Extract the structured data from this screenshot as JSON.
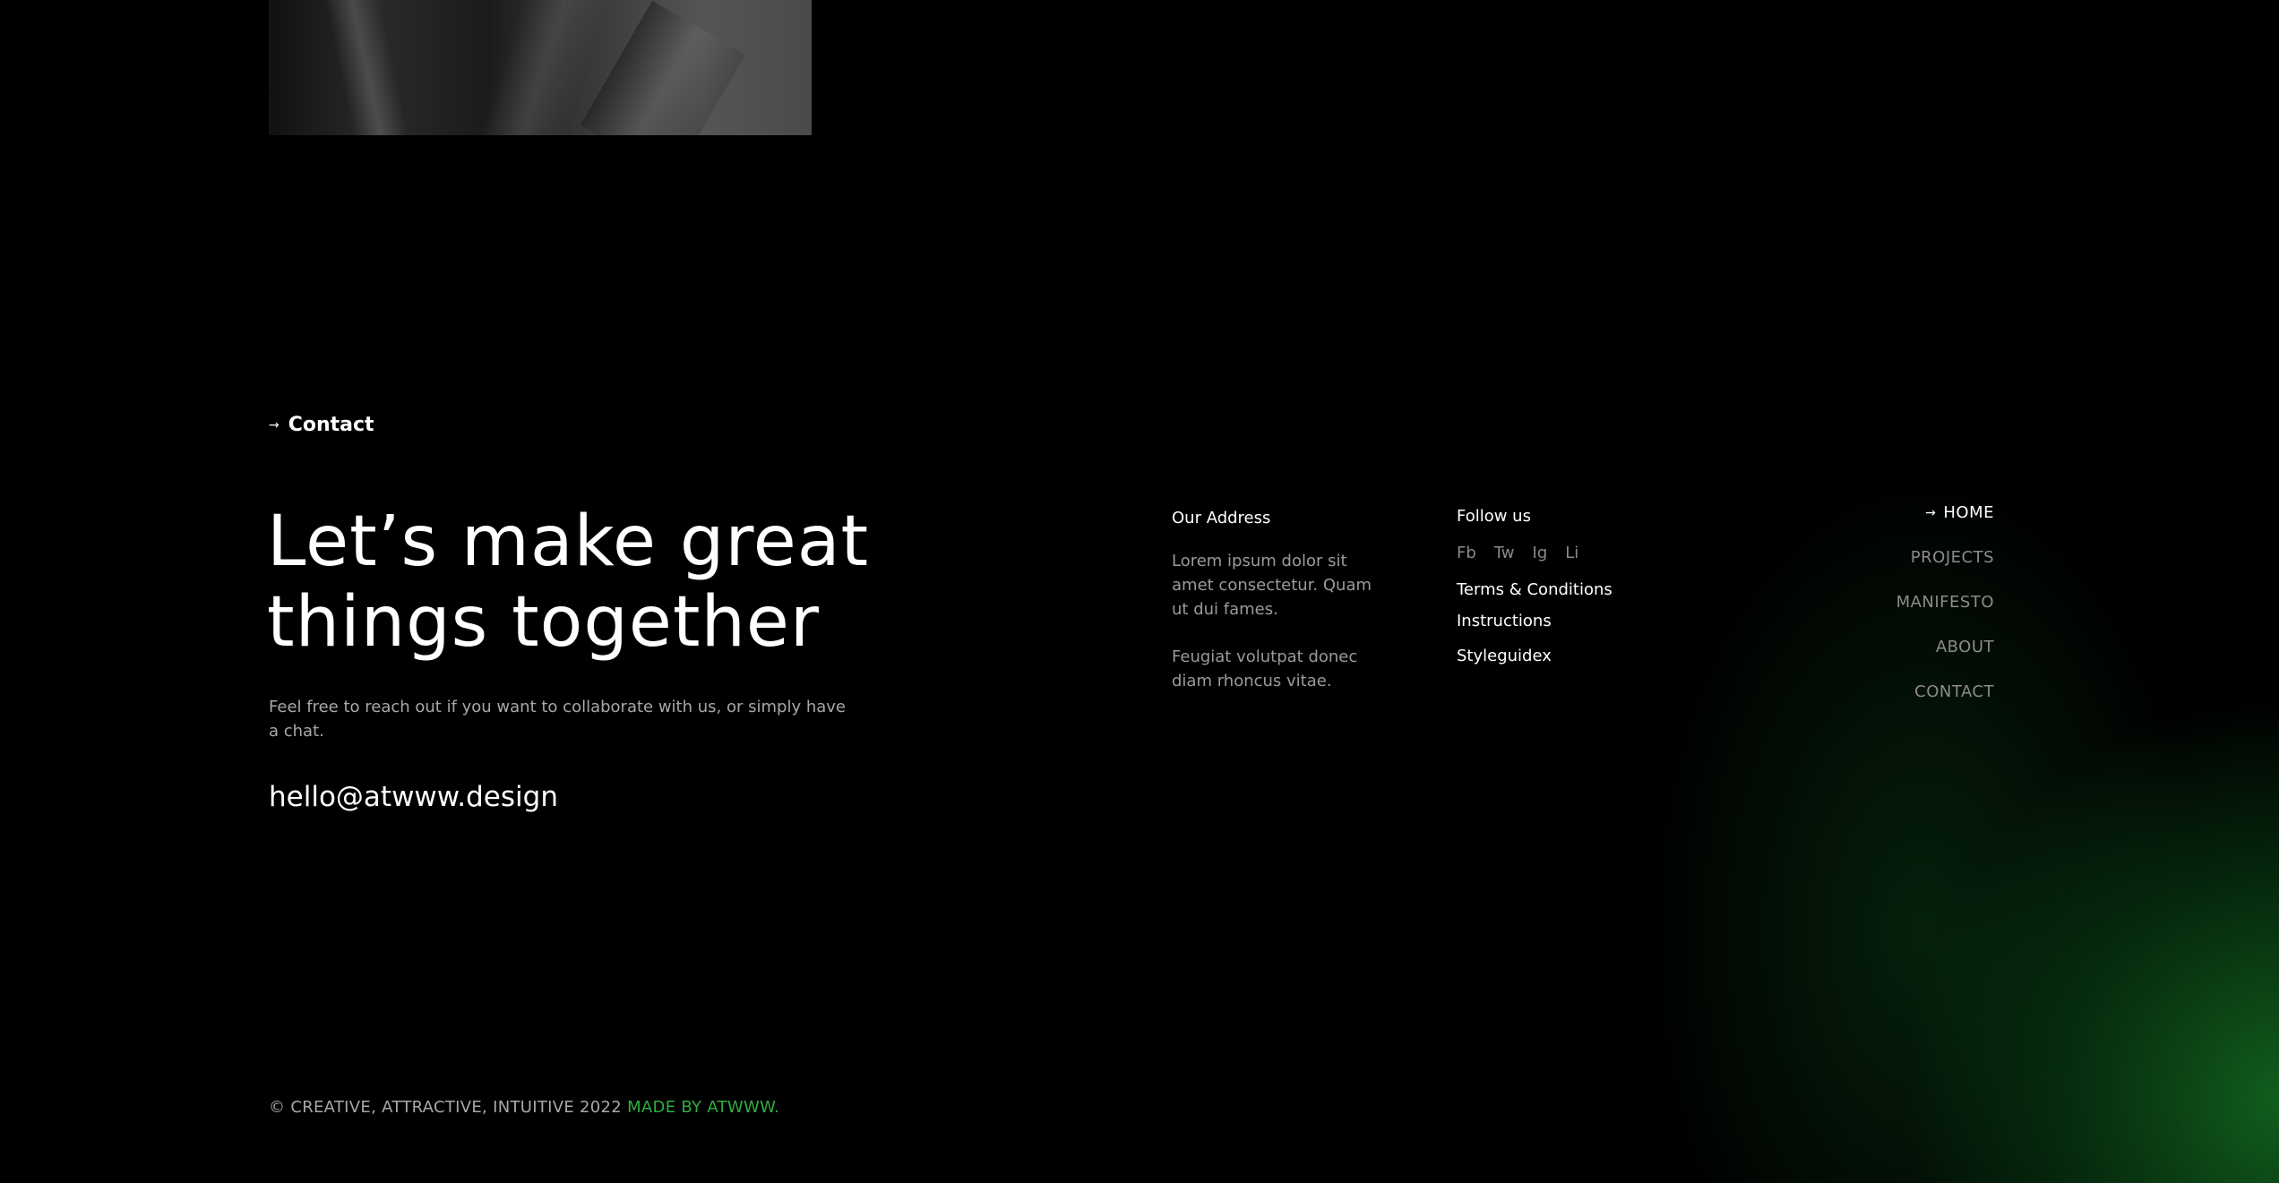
{
  "contact_section": {
    "label": "Contact",
    "headline_line1": "Let’s make great",
    "headline_line2": "things together",
    "subtext": "Feel free to reach out if you want to collaborate with us, or simply have a chat.",
    "email": "hello@atwww.design"
  },
  "address": {
    "title": "Our Address",
    "line1": "Lorem ipsum dolor sit amet consectetur. Quam ut dui fames.",
    "line2": "Feugiat volutpat donec diam rhoncus vitae."
  },
  "follow": {
    "title": "Follow us",
    "socials": [
      "Fb",
      "Tw",
      "Ig",
      "Li"
    ],
    "links": [
      "Terms & Conditions",
      "Instructions",
      "Styleguidex"
    ]
  },
  "nav": {
    "items": [
      "HOME",
      "PROJECTS",
      "MANIFESTO",
      "ABOUT",
      "CONTACT"
    ],
    "active": "HOME"
  },
  "footer": {
    "copyright": "© CREATIVE, ATTRACTIVE, INTUITIVE 2022",
    "made_by": "MADE BY ATWWW."
  },
  "colors": {
    "background": "#000000",
    "accent_green": "#2fae3f",
    "muted_text": "#a8a8a8"
  },
  "icons": {
    "arrow": "arrow-right-icon"
  }
}
